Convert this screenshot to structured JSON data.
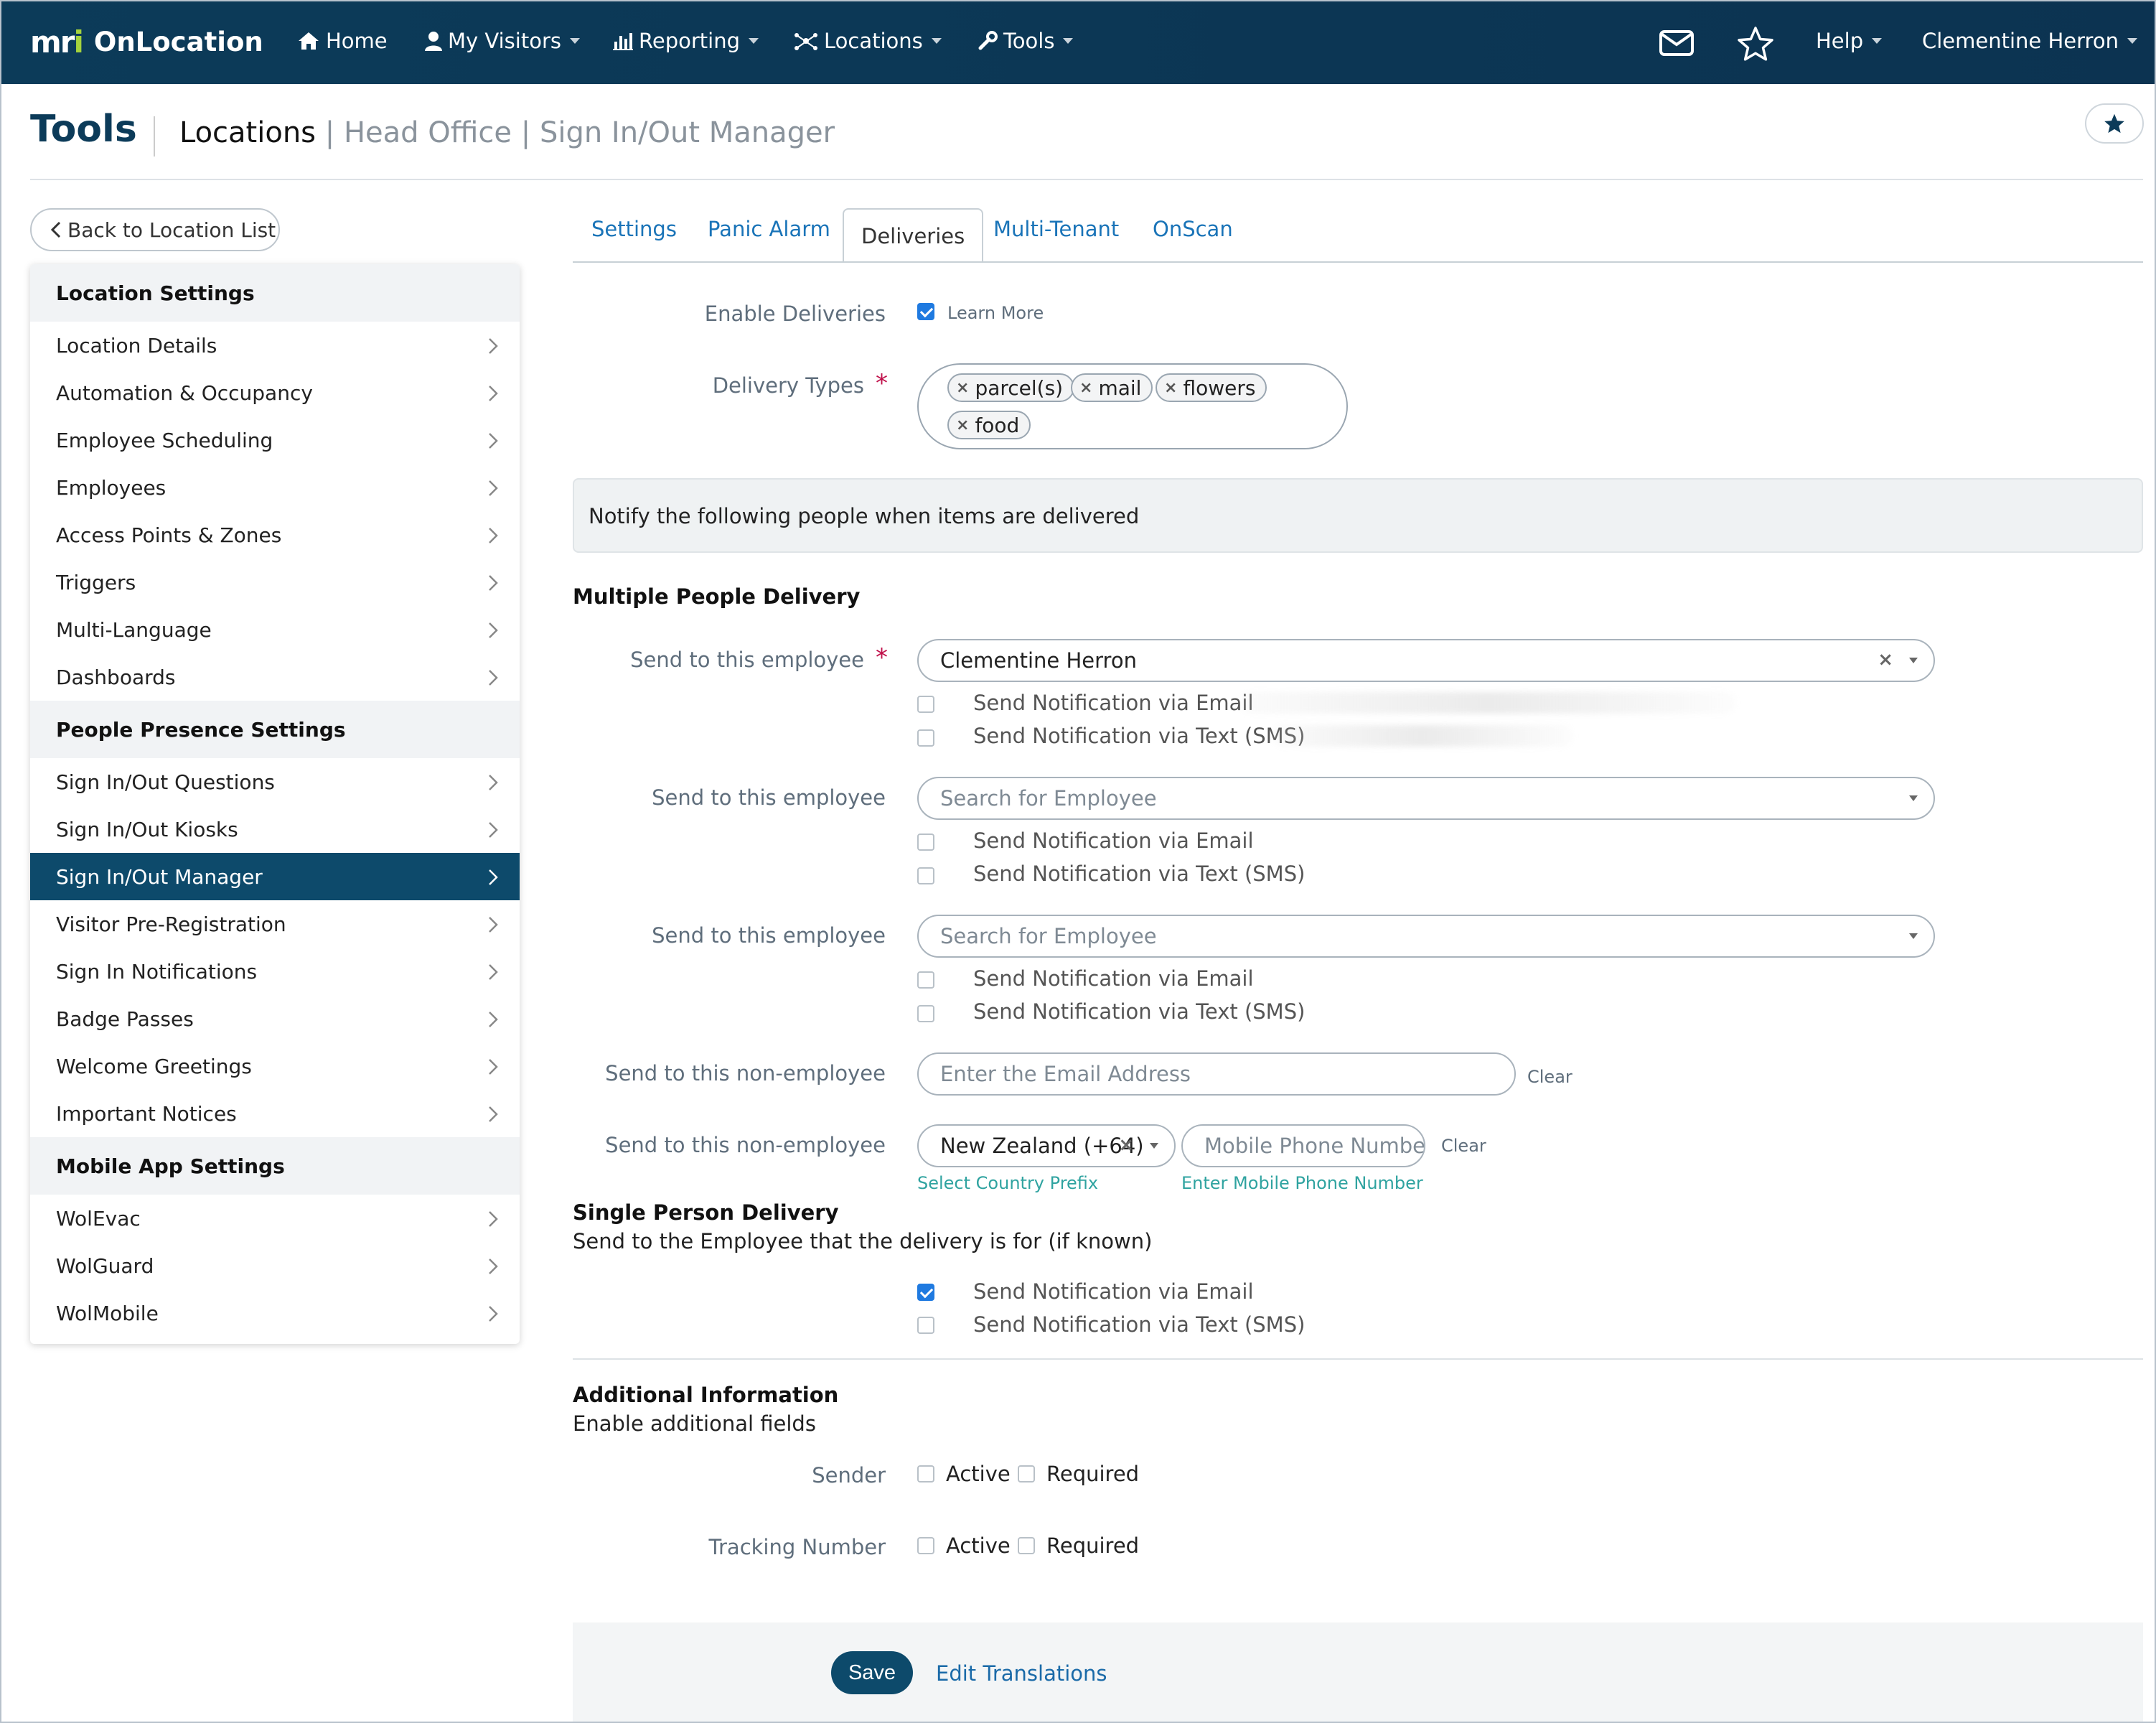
{
  "nav": {
    "brand_mark_a": "m",
    "brand_mark_b": "r",
    "brand_mark_c": "i",
    "brand_name": "OnLocation",
    "items": [
      "Home",
      "My Visitors",
      "Reporting",
      "Locations",
      "Tools"
    ],
    "help": "Help",
    "user": "Clementine Herron"
  },
  "header": {
    "title": "Tools",
    "crumb_main": "Locations",
    "crumb_sep": "|",
    "crumb_1": "Head Office",
    "crumb_2": "Sign In/Out Manager"
  },
  "back_label": "Back to Location List",
  "sidebar": {
    "sections": [
      "Location Settings",
      "People Presence Settings",
      "Mobile App Settings"
    ],
    "location_items": [
      "Location Details",
      "Automation & Occupancy",
      "Employee Scheduling",
      "Employees",
      "Access Points & Zones",
      "Triggers",
      "Multi-Language",
      "Dashboards"
    ],
    "presence_items": [
      "Sign In/Out Questions",
      "Sign In/Out Kiosks",
      "Sign In/Out Manager",
      "Visitor Pre-Registration",
      "Sign In Notifications",
      "Badge Passes",
      "Welcome Greetings",
      "Important Notices"
    ],
    "mobile_items": [
      "WolEvac",
      "WolGuard",
      "WolMobile"
    ],
    "active": "Sign In/Out Manager"
  },
  "tabs": [
    "Settings",
    "Panic Alarm",
    "Deliveries",
    "Multi-Tenant",
    "OnScan"
  ],
  "active_tab": "Deliveries",
  "form": {
    "enable_deliveries_label": "Enable Deliveries",
    "learn_more": "Learn More",
    "delivery_types_label": "Delivery Types",
    "required_mark": "*",
    "delivery_types": [
      "parcel(s)",
      "mail",
      "flowers",
      "food"
    ],
    "notify_text": "Notify the following people when items are delivered",
    "multiple_heading": "Multiple People Delivery",
    "send_employee_label": "Send to this employee",
    "employee_1": "Clementine Herron",
    "employee_placeholder": "Search for Employee",
    "email_option": "Send Notification via Email",
    "sms_option": "Send Notification via Text (SMS)",
    "non_employee_label": "Send to this non-employee",
    "email_placeholder": "Enter the Email Address",
    "clear": "Clear",
    "country": "New Zealand (+64)",
    "phone_placeholder": "Mobile Phone Number",
    "country_help": "Select Country Prefix",
    "phone_help": "Enter Mobile Phone Number",
    "single_heading": "Single Person Delivery",
    "single_desc": "Send to the Employee that the delivery is for (if known)",
    "additional_heading": "Additional Information",
    "additional_desc": "Enable additional fields",
    "sender_label": "Sender",
    "tracking_label": "Tracking Number",
    "active_opt": "Active",
    "required_opt": "Required",
    "save": "Save",
    "edit_translations": "Edit Translations"
  },
  "colors": {
    "nav_bg": "#0c3b59",
    "accent": "#1a74b8",
    "active_row": "#0d4a6b",
    "required": "#c0104a",
    "help_text": "#2fa3a0"
  }
}
